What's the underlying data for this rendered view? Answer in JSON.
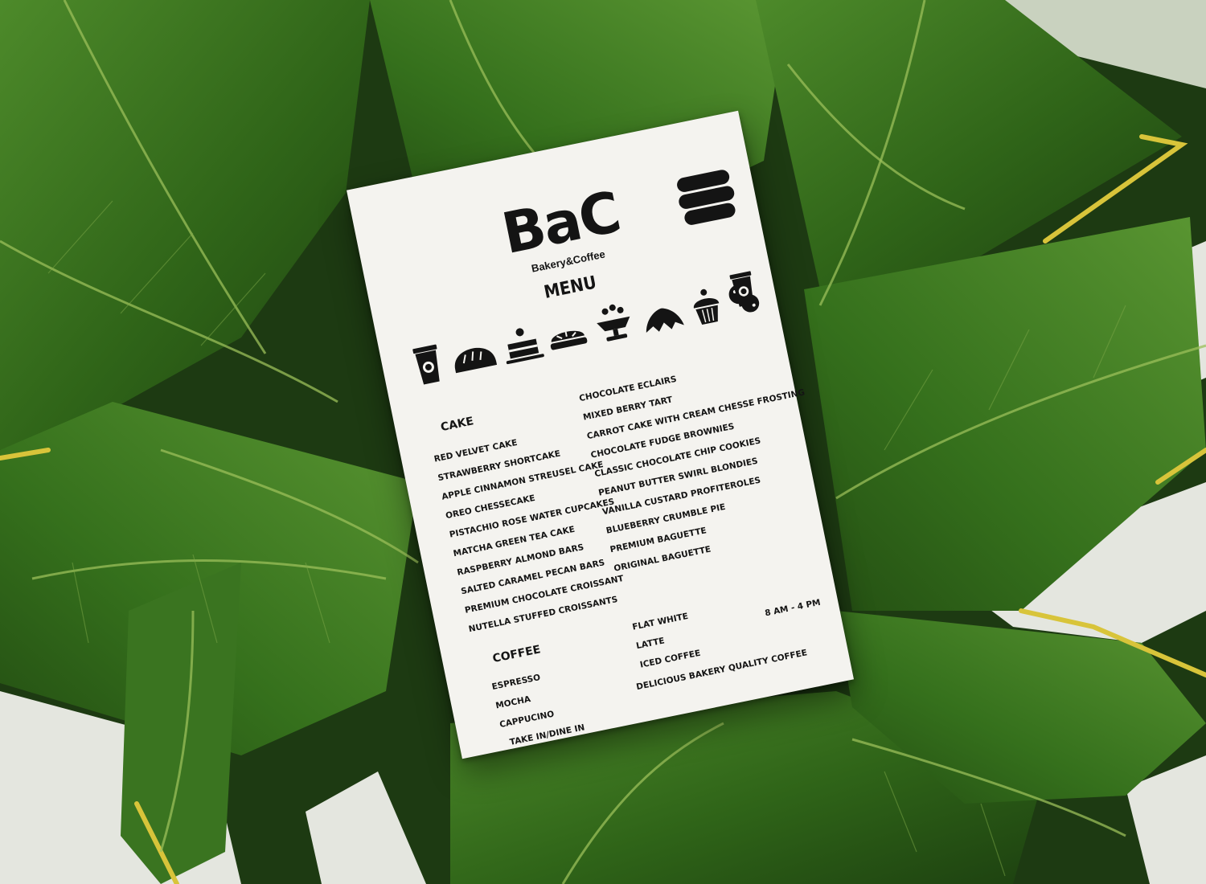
{
  "brand": {
    "logo": "BaC",
    "tagline": "Bakery&Coffee"
  },
  "menu_title": "MENU",
  "icons": [
    "coffee-cup-icon",
    "bread-loaf-icon",
    "cake-slice-icon",
    "pie-icon",
    "dessert-cup-icon",
    "croissant-icon",
    "cupcake-icon",
    "cookies-icon",
    "coffee-cup-icon"
  ],
  "sections": {
    "cake": {
      "title": "CAKE",
      "items": [
        "RED VELVET CAKE",
        "STRAWBERRY SHORTCAKE",
        "APPLE CINNAMON STREUSEL CAKE",
        "OREO CHESSECAKE",
        "PISTACHIO ROSE WATER CUPCAKES",
        "MATCHA GREEN TEA CAKE",
        "RASPBERRY ALMOND BARS",
        "SALTED CARAMEL PECAN BARS",
        "PREMIUM CHOCOLATE CROISSANT",
        "NUTELLA STUFFED CROISSANTS"
      ],
      "items_right": [
        "CHOCOLATE ECLAIRS",
        "MIXED BERRY TART",
        "CARROT CAKE WITH CREAM CHESSE FROSTING",
        "CHOCOLATE FUDGE BROWNIES",
        "CLASSIC CHOCOLATE CHIP COOKIES",
        "PEANUT BUTTER SWIRL BLONDIES",
        "VANILLA CUSTARD PROFITEROLES",
        "BLUEBERRY CRUMBLE PIE",
        "PREMIUM BAGUETTE",
        "ORIGINAL BAGUETTE"
      ]
    },
    "coffee": {
      "title": "COFFEE",
      "items": [
        "ESPRESSO",
        "MOCHA",
        "CAPPUCINO"
      ],
      "items_right": [
        "FLAT WHITE",
        "LATTE",
        "ICED COFFEE"
      ]
    }
  },
  "footer": {
    "hours": "8 AM - 4 PM",
    "slogan": "DELICIOUS BAKERY QUALITY COFFEE",
    "service": "TAKE IN/DINE IN"
  },
  "colors": {
    "leaf_dark": "#1e3d14",
    "leaf_mid": "#3f7a22",
    "leaf_vein": "#9bbf5a",
    "leaf_edge": "#d8c43a",
    "wall": "#e6e7e1",
    "card": "#f4f3ef",
    "ink": "#141414"
  }
}
